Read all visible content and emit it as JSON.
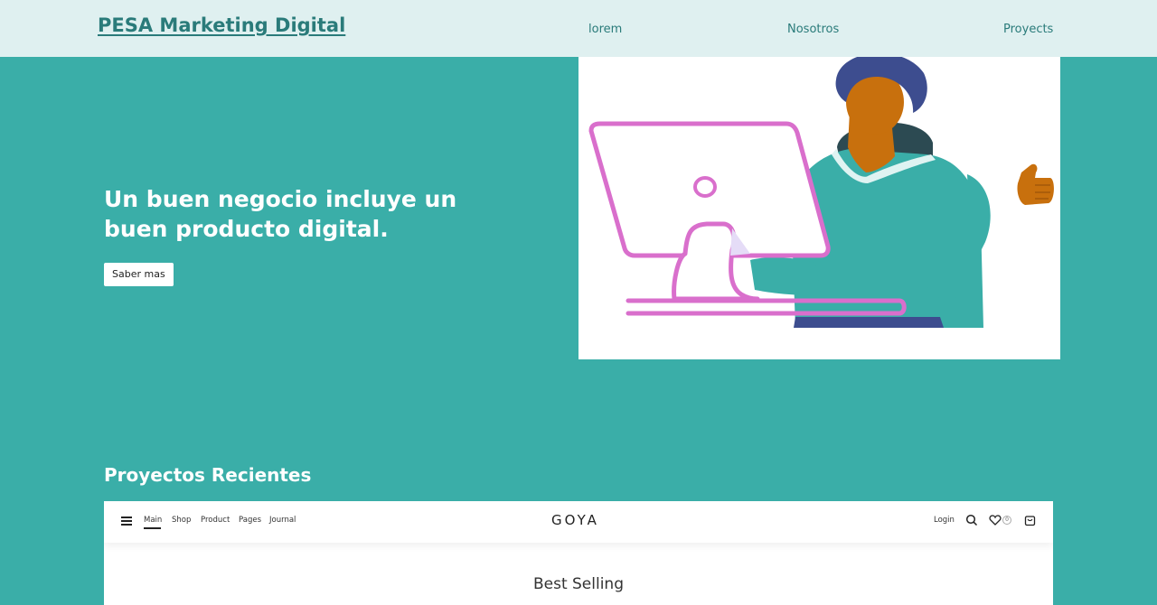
{
  "header": {
    "brand": "PESA Marketing Digital",
    "nav": [
      "lorem",
      "Nosotros",
      "Proyects"
    ]
  },
  "hero": {
    "title": "Un buen negocio incluye un buen producto digital.",
    "button_label": "Saber mas"
  },
  "projects": {
    "title": "Proyectos Recientes",
    "preview": {
      "nav": [
        "Main",
        "Shop",
        "Product",
        "Pages",
        "Journal"
      ],
      "logo": "GOYA",
      "login": "Login",
      "wishlist_count": "0",
      "heading": "Best Selling"
    }
  },
  "colors": {
    "background": "#3aaea8",
    "header_bg": "#dff0f0",
    "brand_text": "#2a7b7a",
    "illustration_monitor": "#d96fcc",
    "illustration_skin": "#c8700d",
    "illustration_hair": "#3d4d8f"
  }
}
